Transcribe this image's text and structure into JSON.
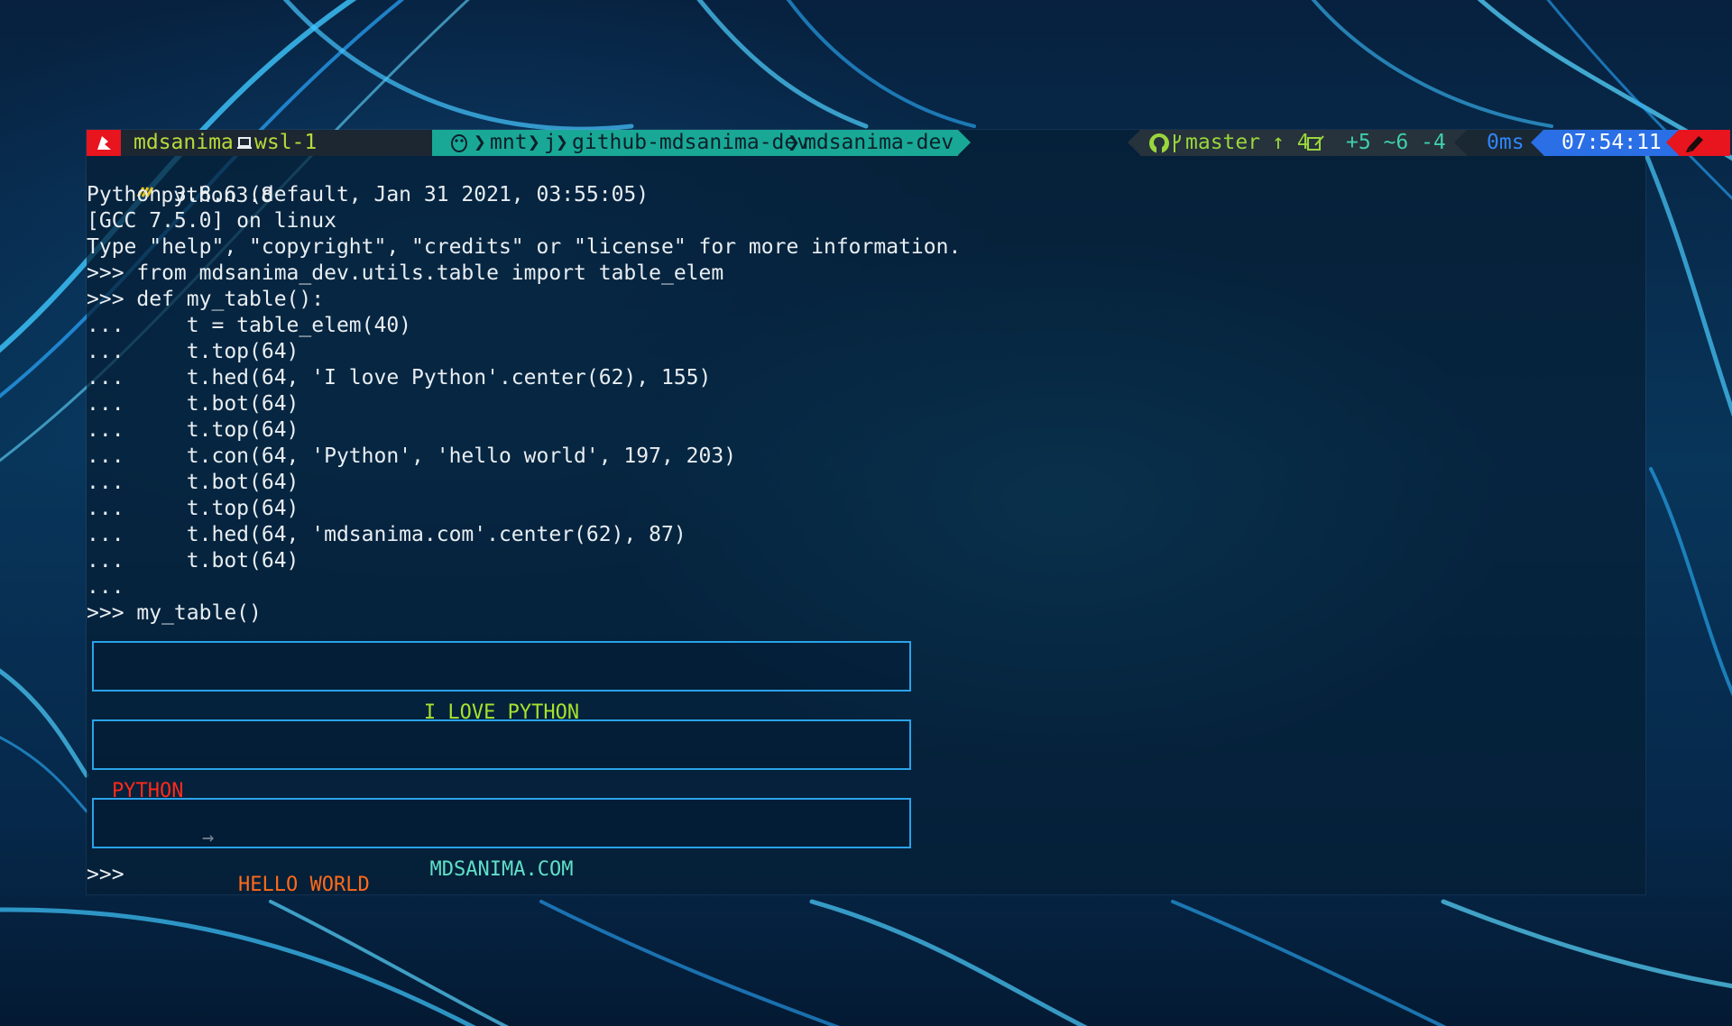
{
  "prompt": {
    "user": "mdsanima",
    "host": "wsl-1",
    "path": [
      "mnt",
      "j",
      "github-mdsanima-dev",
      "mdsanima-dev"
    ],
    "branch": "master",
    "git_status": "↑ 4",
    "git_changes": "+5 ~6 -4",
    "exec_time": "0ms",
    "clock": "07:54:11",
    "icons": [
      "root-icon",
      "laptop-icon",
      "linux-icon",
      "github-icon",
      "branch-icon",
      "edit-icon",
      "pen-icon"
    ]
  },
  "terminal": {
    "lines": [
      "python3.8",
      "Python 3.8.6 (default, Jan 31 2021, 03:55:05)",
      "[GCC 7.5.0] on linux",
      "Type \"help\", \"copyright\", \"credits\" or \"license\" for more information.",
      ">>> from mdsanima_dev.utils.table import table_elem",
      ">>> def my_table():",
      "...     t = table_elem(40)",
      "...     t.top(64)",
      "...     t.hed(64, 'I love Python'.center(62), 155)",
      "...     t.bot(64)",
      "...     t.top(64)",
      "...     t.con(64, 'Python', 'hello world', 197, 203)",
      "...     t.bot(64)",
      "...     t.top(64)",
      "...     t.hed(64, 'mdsanima.com'.center(62), 87)",
      "...     t.bot(64)",
      "...",
      ">>> my_table()"
    ],
    "final_prompt": ">>>"
  },
  "tables": {
    "header1": "I LOVE PYTHON",
    "content_key": "PYTHON",
    "content_arrow": "→",
    "content_value": "HELLO WORLD",
    "header2": "MDSANIMA.COM"
  },
  "colors": {
    "root_segment": "#e8141e",
    "path_segment": "#19a896",
    "clock_segment": "#2a6fe6",
    "table_border": "#2aa3e8",
    "header1_text": "#a6e22e",
    "key_text": "#ff2a1a",
    "value_text": "#ff6a1a",
    "header2_text": "#5fe0c8"
  }
}
